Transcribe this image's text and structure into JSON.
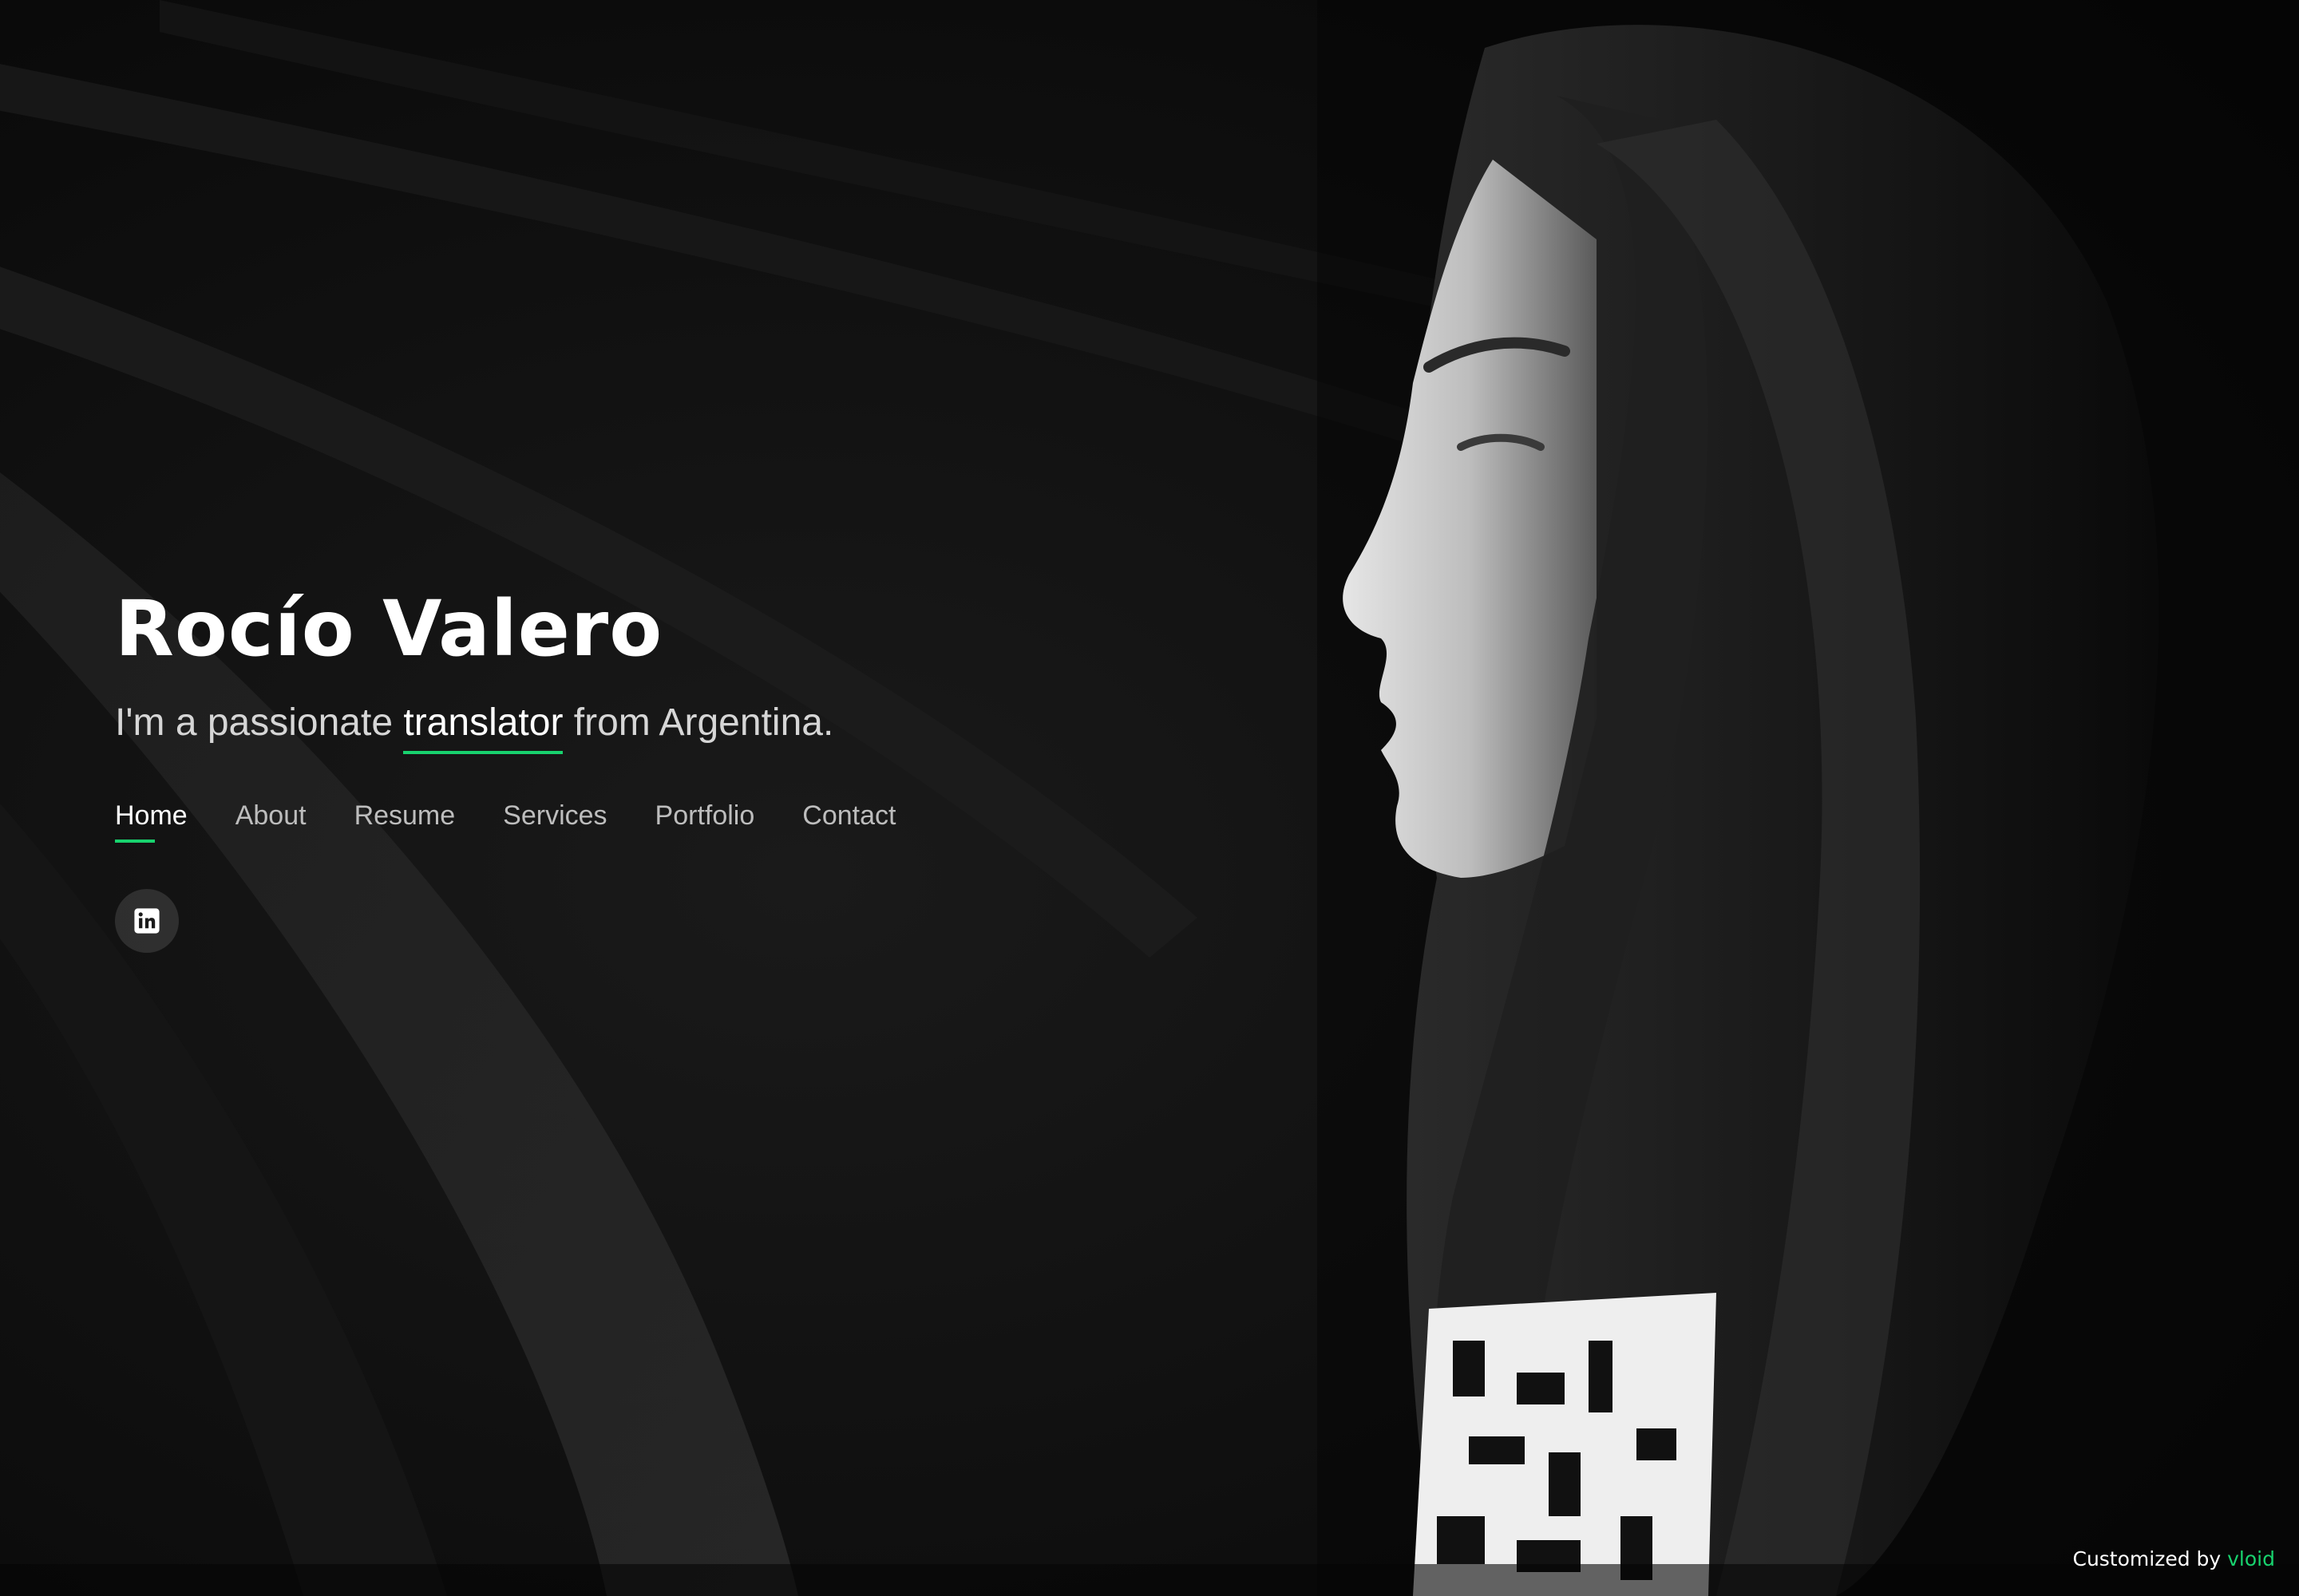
{
  "hero": {
    "name": "Rocío Valero",
    "tagline_prefix": "I'm a passionate ",
    "tagline_typed": "translator",
    "tagline_suffix": " from Argentina."
  },
  "nav": {
    "items": [
      {
        "label": "Home",
        "active": true
      },
      {
        "label": "About",
        "active": false
      },
      {
        "label": "Resume",
        "active": false
      },
      {
        "label": "Services",
        "active": false
      },
      {
        "label": "Portfolio",
        "active": false
      },
      {
        "label": "Contact",
        "active": false
      }
    ]
  },
  "social": {
    "items": [
      {
        "icon": "linkedin-icon"
      }
    ]
  },
  "footer": {
    "credit_prefix": "Customized by ",
    "credit_link": "vloid"
  },
  "colors": {
    "accent": "#18d26e",
    "background": "#0b0b0b",
    "text": "#ffffff",
    "muted_text": "#bdbdbd"
  }
}
